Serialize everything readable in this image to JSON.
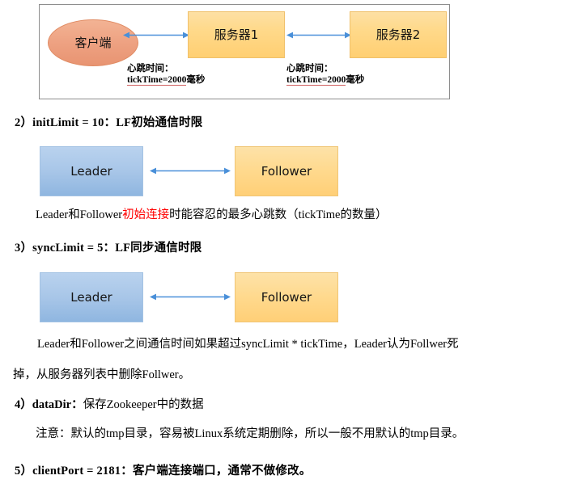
{
  "figure1": {
    "client_label": "客户端",
    "server1_label": "服务器1",
    "server2_label": "服务器2",
    "heartbeat1": {
      "title": "心跳时间：",
      "key": "tickTime=2000",
      "unit": "毫秒"
    },
    "heartbeat2": {
      "title": "心跳时间：",
      "key": "tickTime=2000",
      "unit": "毫秒"
    },
    "arrow_color": "#4a90d9",
    "client_color": "#eda080",
    "server_color": "#ffd98a",
    "frame_border_color": "#8d8d8d"
  },
  "sections": {
    "s2": {
      "heading": "2）initLimit = 10：LF初始通信时限",
      "leader_label": "Leader",
      "follower_label": "Follower",
      "caption_pre": "Leader和Follower",
      "caption_red": "初始连接",
      "caption_post": "时能容忍的最多心跳数（tickTime的数量）"
    },
    "s3": {
      "heading": "3）syncLimit = 5：LF同步通信时限",
      "leader_label": "Leader",
      "follower_label": "Follower",
      "caption_line1": "Leader和Follower之间通信时间如果超过syncLimit * tickTime，Leader认为Follwer死",
      "caption_line2": "掉，从服务器列表中删除Follwer。"
    },
    "s4": {
      "heading_bold": "4）dataDir：",
      "heading_rest": "保存Zookeeper中的数据",
      "note": "注意：默认的tmp目录，容易被Linux系统定期删除，所以一般不用默认的tmp目录。"
    },
    "s5": {
      "heading": "5）clientPort = 2181：客户端连接端口，通常不做修改。"
    }
  },
  "colors": {
    "leader_blue": "#a8c6e8",
    "follower_orange": "#ffd98d",
    "accent_red": "#ff0000",
    "arrow_blue": "#4a90d9"
  }
}
